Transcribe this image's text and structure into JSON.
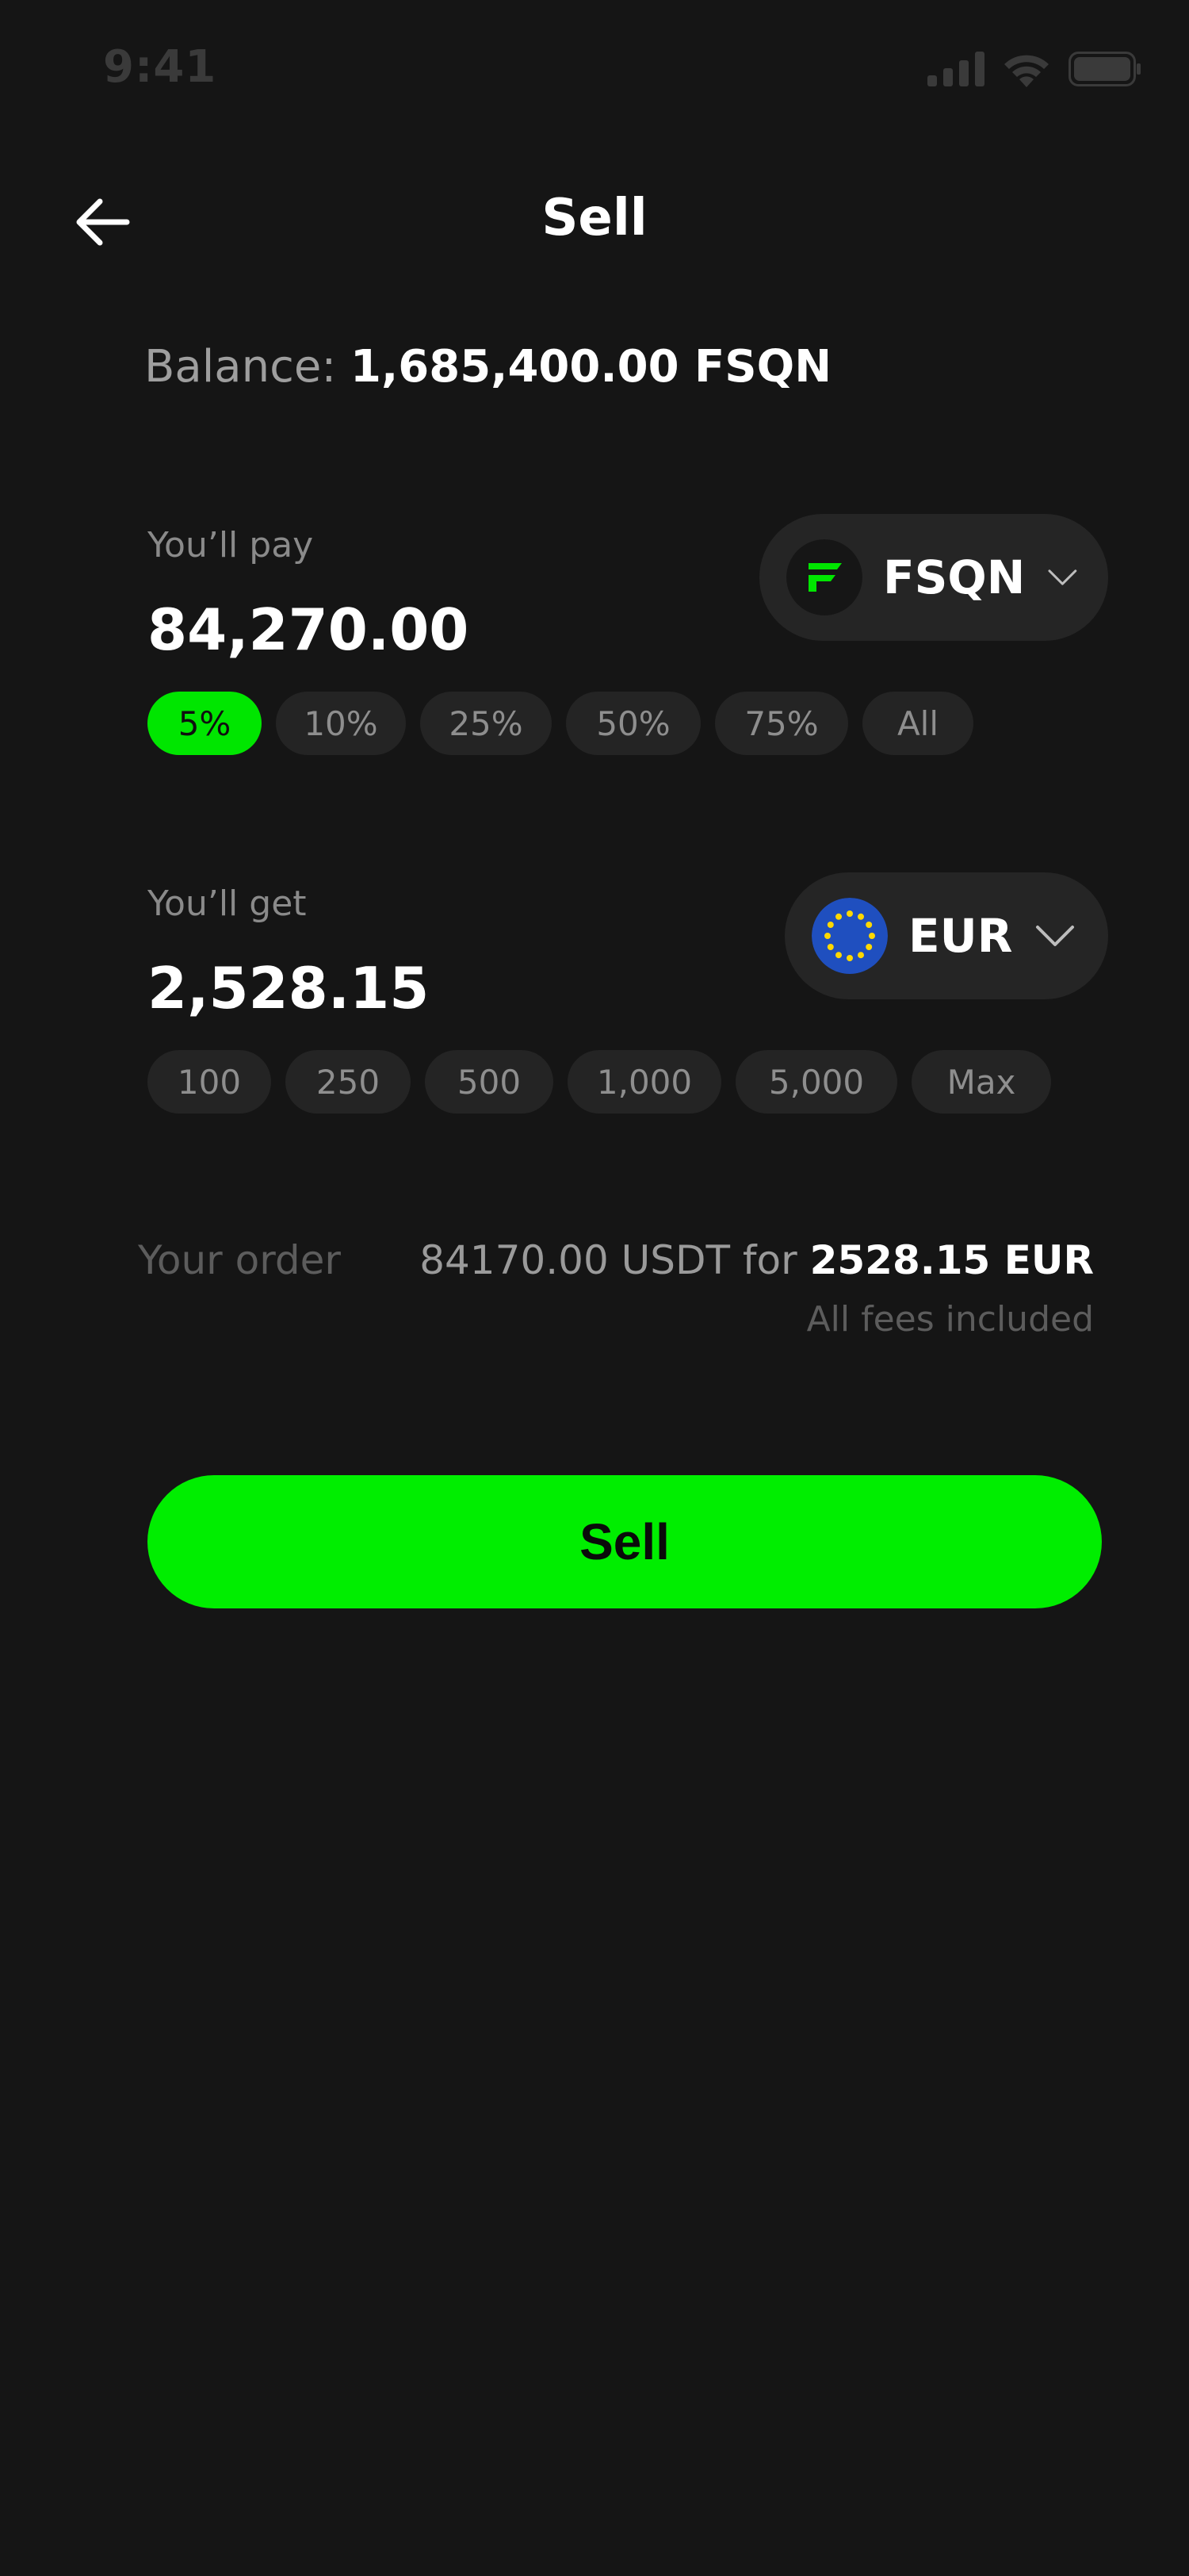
{
  "status_bar": {
    "time": "9:41"
  },
  "header": {
    "title": "Sell"
  },
  "balance": {
    "label": "Balance:",
    "value": "1,685,400.00 FSQN"
  },
  "pay": {
    "label": "You’ll pay",
    "amount": "84,270.00",
    "currency": "FSQN",
    "chips": [
      "5%",
      "10%",
      "25%",
      "50%",
      "75%",
      "All"
    ],
    "active_chip": "5%"
  },
  "get": {
    "label": "You’ll get",
    "amount": "2,528.15",
    "currency": "EUR",
    "chips": [
      "100",
      "250",
      "500",
      "1,000",
      "5,000",
      "Max"
    ]
  },
  "order": {
    "label": "Your order",
    "pay_text": "84170.00 USDT for",
    "get_text": "2528.15 EUR",
    "fees": "All fees included"
  },
  "actions": {
    "sell_label": "Sell"
  },
  "colors": {
    "accent": "#00ee00",
    "background": "#151515",
    "chip": "#242424"
  },
  "icons": {
    "back": "arrow-left-icon",
    "fsqn": "fsqn-logo-icon",
    "eur": "eu-flag-icon",
    "dropdown": "chevron-down-icon"
  }
}
